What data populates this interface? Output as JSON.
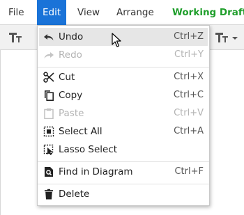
{
  "menubar": {
    "items": [
      {
        "label": "File"
      },
      {
        "label": "Edit"
      },
      {
        "label": "View"
      },
      {
        "label": "Arrange"
      }
    ],
    "document_title": "Working Draft ."
  },
  "colors": {
    "accent": "#1a73d8",
    "title_green": "#1e9e2a",
    "hover": "#e6e6e6"
  },
  "toolbar": {
    "left_icon": "text-format-icon",
    "right_icon": "text-format-dropdown-icon"
  },
  "edit_menu": {
    "items": [
      {
        "label": "Undo",
        "shortcut": "Ctrl+Z",
        "icon": "undo-icon",
        "enabled": true,
        "hovered": true
      },
      {
        "label": "Redo",
        "shortcut": "Ctrl+Y",
        "icon": "redo-icon",
        "enabled": false
      },
      {
        "label": "Cut",
        "shortcut": "Ctrl+X",
        "icon": "scissors-icon",
        "enabled": true
      },
      {
        "label": "Copy",
        "shortcut": "Ctrl+C",
        "icon": "copy-icon",
        "enabled": true
      },
      {
        "label": "Paste",
        "shortcut": "Ctrl+V",
        "icon": "clipboard-icon",
        "enabled": false
      },
      {
        "label": "Select All",
        "shortcut": "Ctrl+A",
        "icon": "select-all-icon",
        "enabled": true
      },
      {
        "label": "Lasso Select",
        "shortcut": "",
        "icon": "lasso-select-icon",
        "enabled": true
      },
      {
        "label": "Find in Diagram",
        "shortcut": "Ctrl+F",
        "icon": "find-in-page-icon",
        "enabled": true
      },
      {
        "label": "Delete",
        "shortcut": "",
        "icon": "trash-icon",
        "enabled": true
      }
    ]
  }
}
